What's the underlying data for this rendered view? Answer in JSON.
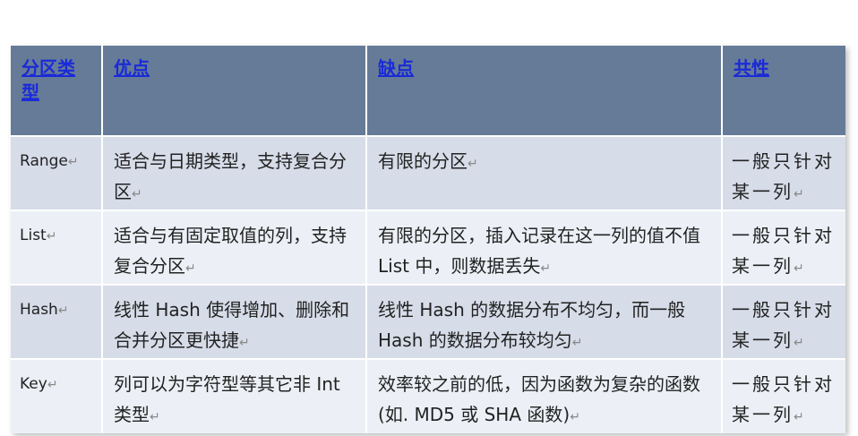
{
  "header": {
    "col1": "分区类型",
    "col2": "优点",
    "col3": "缺点",
    "col4": "共性"
  },
  "rows": [
    {
      "type": "Range",
      "pros": "适合与日期类型，支持复合分区",
      "cons": "有限的分区",
      "common": "一般只针对某一列"
    },
    {
      "type": "List",
      "pros": "适合与有固定取值的列，支持复合分区",
      "cons": "有限的分区，插入记录在这一列的值不值 List 中，则数据丢失",
      "common": "一般只针对某一列"
    },
    {
      "type": "Hash",
      "pros": "线性 Hash 使得增加、删除和合并分区更快捷",
      "cons": "线性 Hash 的数据分布不均匀，而一般 Hash 的数据分布较均匀",
      "common": "一般只针对某一列"
    },
    {
      "type": "Key",
      "pros": "列可以为字符型等其它非 Int 类型",
      "cons": "效率较之前的低，因为函数为复杂的函数(如. MD5 或 SHA 函数)",
      "common": "一般只针对某一列"
    }
  ],
  "colors": {
    "header_bg": "#667b97",
    "link": "#1a2ad8",
    "row_odd": "#d6dce8",
    "row_even": "#ecf0f6"
  }
}
